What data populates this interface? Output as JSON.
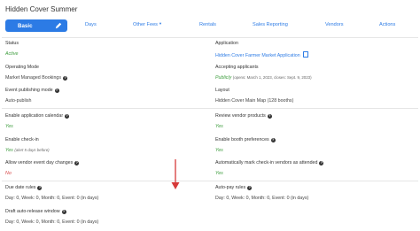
{
  "page_title": "Hidden Cover Summer",
  "nav": {
    "basic": "Basic",
    "days": "Days",
    "other_fees": "Other Fees",
    "rentals": "Rentals",
    "sales_reporting": "Sales Reporting",
    "vendors": "Vendors",
    "actions": "Actions"
  },
  "fields": {
    "status": {
      "label": "Status",
      "value": "Active"
    },
    "application": {
      "label": "Application",
      "value": "Hidden Cover Farmer Market Application"
    },
    "operating_mode": {
      "label": "Operating Mode",
      "value": "Market Managed Bookings"
    },
    "accepting_applicants": {
      "label": "Accepting applicants",
      "value": "Publicly",
      "detail": "(opens: March 1, 2023, closes: Sept. 9, 2023)"
    },
    "event_publishing_mode": {
      "label": "Event publishing mode",
      "value": "Auto-publish"
    },
    "layout": {
      "label": "Layout",
      "value": "Hidden Cover Main Map (128 booths)"
    },
    "enable_application_calendar": {
      "label": "Enable application calendar",
      "value": "Yes"
    },
    "review_vendor_products": {
      "label": "Review vendor products",
      "value": "Yes"
    },
    "enable_check_in": {
      "label": "Enable check-in",
      "value": "Yes",
      "detail": "(alert 5 days before)"
    },
    "enable_booth_preferences": {
      "label": "Enable booth preferences",
      "value": "Yes"
    },
    "allow_vendor_event_day_changes": {
      "label": "Allow vendor event day changes",
      "value": "No"
    },
    "auto_mark_check_in": {
      "label": "Automatically mark check-in vendors as attended",
      "value": "Yes"
    },
    "due_date_rules": {
      "label": "Due date rules",
      "value": "Day: 0, Week: 0, Month: 0, Event: 0 (in days)"
    },
    "auto_pay_rules": {
      "label": "Auto-pay rules",
      "value": "Day: 0, Week: 0, Month: 0, Event: 0 (in days)"
    },
    "draft_auto_release_window": {
      "label": "Draft auto-release window",
      "value": "Day: 0, Week: 0, Month: 0, Event: 0 (in days)"
    }
  },
  "colors": {
    "accent": "#2c7be5",
    "yes": "#3c9c3c",
    "no": "#d64545",
    "arrow": "#d63a3a"
  },
  "icons": [
    "pencil-icon",
    "caret-down-icon",
    "document-icon",
    "help-icon",
    "arrow-down-icon"
  ]
}
